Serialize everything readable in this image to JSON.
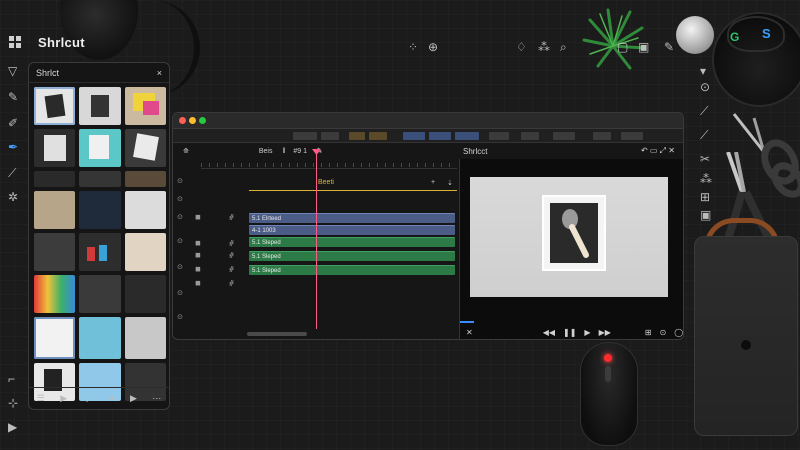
{
  "app": {
    "title": "Shrlcut",
    "icons": [
      "grid-icon",
      "target-icon",
      "drop-icon",
      "sparkle-icon",
      "search-icon",
      "folder-icon",
      "save-icon",
      "pen-icon",
      "gear-icon",
      "window-icon"
    ]
  },
  "media_panel": {
    "title": "Shrlct",
    "close": "×",
    "thumbnail_rows": 8,
    "footer_icons": [
      "sort-icon",
      "play-forward-icon",
      "grid-view-icon",
      "arrow-icon",
      "play-icon",
      "more-icon"
    ]
  },
  "editor": {
    "timecode": "Beis",
    "markers": [
      "ǁ",
      "#9 1",
      "⁂"
    ],
    "preview_title": "Shrlcct",
    "ruler_label": "Beeti",
    "tracks": [
      {
        "label": "5.1 Elrteed",
        "color": "blue"
      },
      {
        "label": "4-1 1003",
        "color": "blue"
      },
      {
        "label": "5.1 Sleped",
        "color": "green"
      },
      {
        "label": "5.1 Sleped",
        "color": "green"
      },
      {
        "label": "5.1 Sleped",
        "color": "green"
      }
    ],
    "controls": [
      "✕",
      "◀◀",
      "❚❚",
      "▶",
      "▶▶",
      "⊞",
      "⊙",
      "◯"
    ]
  },
  "colors": {
    "accent_pink": "#ff5a8a",
    "clip_blue": "#4b5d86",
    "clip_green": "#2c7b46",
    "marker_yellow": "#d8b33a",
    "progress_blue": "#3a8bff",
    "panel_bg": "#151515"
  }
}
